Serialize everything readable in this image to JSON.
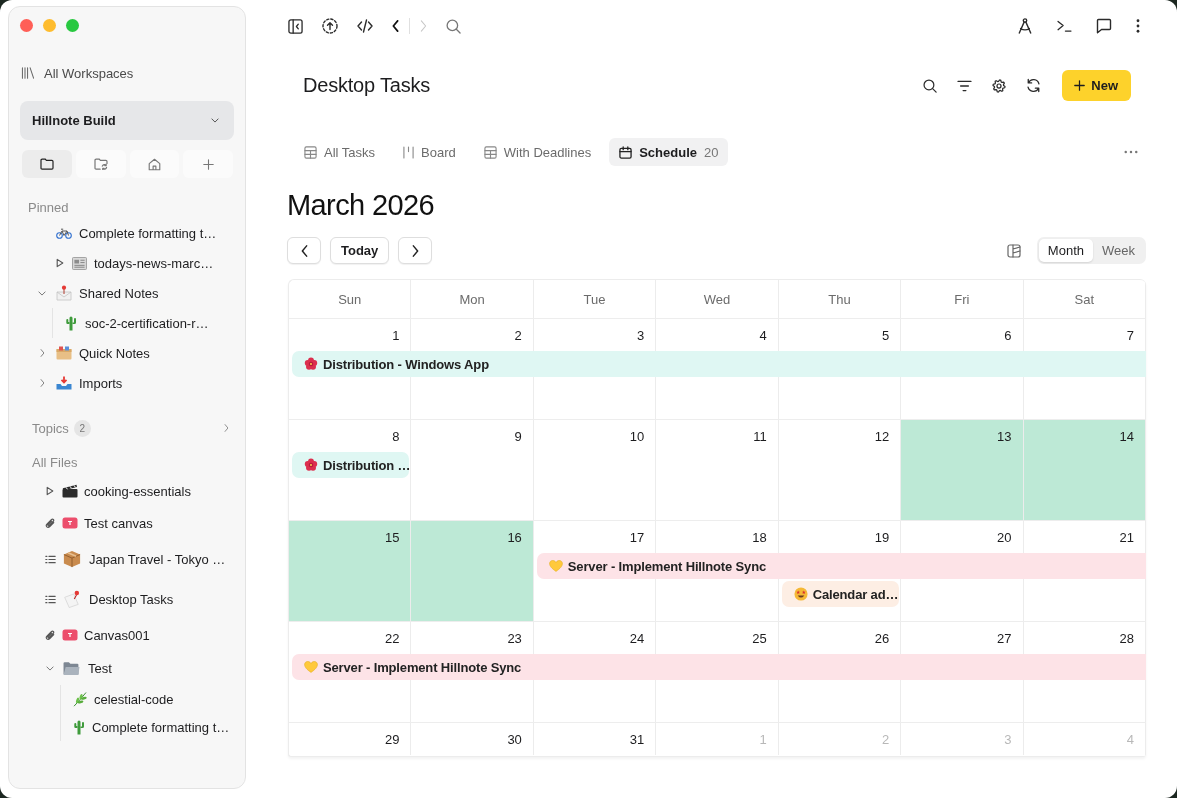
{
  "window_controls": [
    {
      "color": "#ff5f57"
    },
    {
      "color": "#febc2e"
    },
    {
      "color": "#28c840"
    }
  ],
  "sidebar": {
    "workspaces_link": "All Workspaces",
    "workspace": "Hillnote Build",
    "view_tabs": [
      {
        "kind": "files",
        "selected": true
      },
      {
        "kind": "shared",
        "selected": false
      },
      {
        "kind": "home",
        "selected": false
      },
      {
        "kind": "add",
        "selected": false
      }
    ],
    "pinned": {
      "heading": "Pinned",
      "items": [
        {
          "label": "Complete formatting t…",
          "kind": "note"
        },
        {
          "label": "todays-news-marc…",
          "kind": "media"
        },
        {
          "label": "Shared Notes",
          "kind": "folder",
          "expanded": true,
          "children": [
            {
              "label": "soc-2-certification-r…"
            }
          ]
        },
        {
          "label": "Quick Notes",
          "kind": "folder",
          "expanded": false
        },
        {
          "label": "Imports",
          "kind": "folder",
          "expanded": false
        }
      ]
    },
    "topics": {
      "label": "Topics",
      "count": "2"
    },
    "files": {
      "heading": "All Files",
      "items": [
        {
          "label": "cooking-essentials",
          "kind": "media"
        },
        {
          "label": "Test canvas",
          "kind": "canvas"
        },
        {
          "label": "Japan Travel - Tokyo …",
          "kind": "tasks"
        },
        {
          "label": "Desktop Tasks",
          "kind": "tasks"
        },
        {
          "label": "Canvas001",
          "kind": "canvas"
        },
        {
          "label": "Test",
          "kind": "folder",
          "expanded": true,
          "children": [
            {
              "label": "celestial-code"
            },
            {
              "label": "Complete formatting t…"
            }
          ]
        }
      ]
    }
  },
  "toolbar": {
    "history": [
      {
        "kind": "back",
        "disabled": false
      },
      {
        "kind": "forward",
        "disabled": true
      }
    ]
  },
  "header": {
    "title": "Desktop Tasks",
    "new_button": "New"
  },
  "views": [
    {
      "label": "All Tasks",
      "kind": "table",
      "selected": false
    },
    {
      "label": "Board",
      "kind": "board",
      "selected": false
    },
    {
      "label": "With Deadlines",
      "kind": "table",
      "selected": false
    },
    {
      "label": "Schedule",
      "kind": "calendar",
      "selected": true,
      "count": "20"
    }
  ],
  "calendar": {
    "title": "March 2026",
    "today_button": "Today",
    "modes": [
      {
        "label": "Month",
        "selected": true
      },
      {
        "label": "Week",
        "selected": false
      }
    ],
    "weekdays": [
      "Sun",
      "Mon",
      "Tue",
      "Wed",
      "Thu",
      "Fri",
      "Sat"
    ],
    "weeks": [
      {
        "days": [
          {
            "label": "1",
            "outside": false,
            "highlighted": false,
            "events": [
              {
                "title": "Distribution - Windows App",
                "color": "#dff7f3",
                "continues": true
              }
            ]
          },
          {
            "label": "2",
            "outside": false,
            "highlighted": false
          },
          {
            "label": "3",
            "outside": false,
            "highlighted": false
          },
          {
            "label": "4",
            "outside": false,
            "highlighted": false
          },
          {
            "label": "5",
            "outside": false,
            "highlighted": false
          },
          {
            "label": "6",
            "outside": false,
            "highlighted": false
          },
          {
            "label": "7",
            "outside": false,
            "highlighted": false
          }
        ]
      },
      {
        "days": [
          {
            "label": "8",
            "outside": false,
            "highlighted": false,
            "events": [
              {
                "title": "Distribution …",
                "color": "#dff7f3",
                "continues": false
              }
            ]
          },
          {
            "label": "9",
            "outside": false,
            "highlighted": false
          },
          {
            "label": "10",
            "outside": false,
            "highlighted": false
          },
          {
            "label": "11",
            "outside": false,
            "highlighted": false
          },
          {
            "label": "12",
            "outside": false,
            "highlighted": false
          },
          {
            "label": "13",
            "outside": false,
            "highlighted": true
          },
          {
            "label": "14",
            "outside": false,
            "highlighted": true
          }
        ]
      },
      {
        "days": [
          {
            "label": "15",
            "outside": false,
            "highlighted": true
          },
          {
            "label": "16",
            "outside": false,
            "highlighted": true
          },
          {
            "label": "17",
            "outside": false,
            "highlighted": false,
            "events": [
              {
                "title": "Server - Implement Hillnote Sync",
                "color": "#fde3e7",
                "continues": true
              }
            ]
          },
          {
            "label": "18",
            "outside": false,
            "highlighted": false
          },
          {
            "label": "19",
            "outside": false,
            "highlighted": false,
            "events": [
              {
                "title": "Calendar ad…",
                "color": "#fdeee4",
                "continues": false
              }
            ]
          },
          {
            "label": "20",
            "outside": false,
            "highlighted": false
          },
          {
            "label": "21",
            "outside": false,
            "highlighted": false
          }
        ]
      },
      {
        "days": [
          {
            "label": "22",
            "outside": false,
            "highlighted": false,
            "events": [
              {
                "title": "Server - Implement Hillnote Sync",
                "color": "#fde3e7",
                "continues": true
              }
            ]
          },
          {
            "label": "23",
            "outside": false,
            "highlighted": false
          },
          {
            "label": "24",
            "outside": false,
            "highlighted": false
          },
          {
            "label": "25",
            "outside": false,
            "highlighted": false
          },
          {
            "label": "26",
            "outside": false,
            "highlighted": false
          },
          {
            "label": "27",
            "outside": false,
            "highlighted": false
          },
          {
            "label": "28",
            "outside": false,
            "highlighted": false
          }
        ]
      },
      {
        "days": [
          {
            "label": "29",
            "outside": false,
            "highlighted": false
          },
          {
            "label": "30",
            "outside": false,
            "highlighted": false
          },
          {
            "label": "31",
            "outside": false,
            "highlighted": false
          },
          {
            "label": "1",
            "outside": true,
            "highlighted": false
          },
          {
            "label": "2",
            "outside": true,
            "highlighted": false
          },
          {
            "label": "3",
            "outside": true,
            "highlighted": false
          },
          {
            "label": "4",
            "outside": true,
            "highlighted": false
          }
        ]
      }
    ]
  }
}
